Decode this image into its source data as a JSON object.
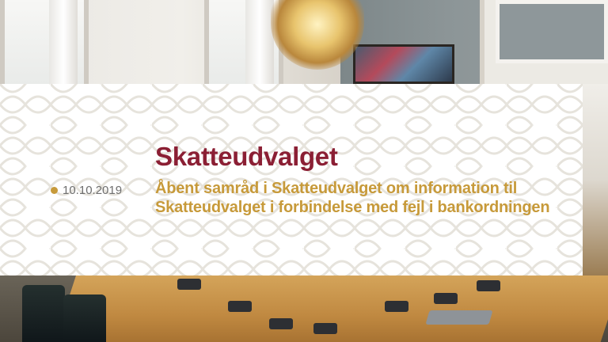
{
  "committee": {
    "name": "Skatteudvalget"
  },
  "meeting": {
    "date": "10.10.2019",
    "description": "Åbent samråd i Skatteudvalget om information til Skatteudvalget i forbindelse med fejl i bankordningen"
  },
  "colors": {
    "title": "#8b1f34",
    "accent": "#c79a3a",
    "date_text": "#6e6e6e",
    "card_background": "#ffffff",
    "pattern_line": "#e6e3dc"
  }
}
